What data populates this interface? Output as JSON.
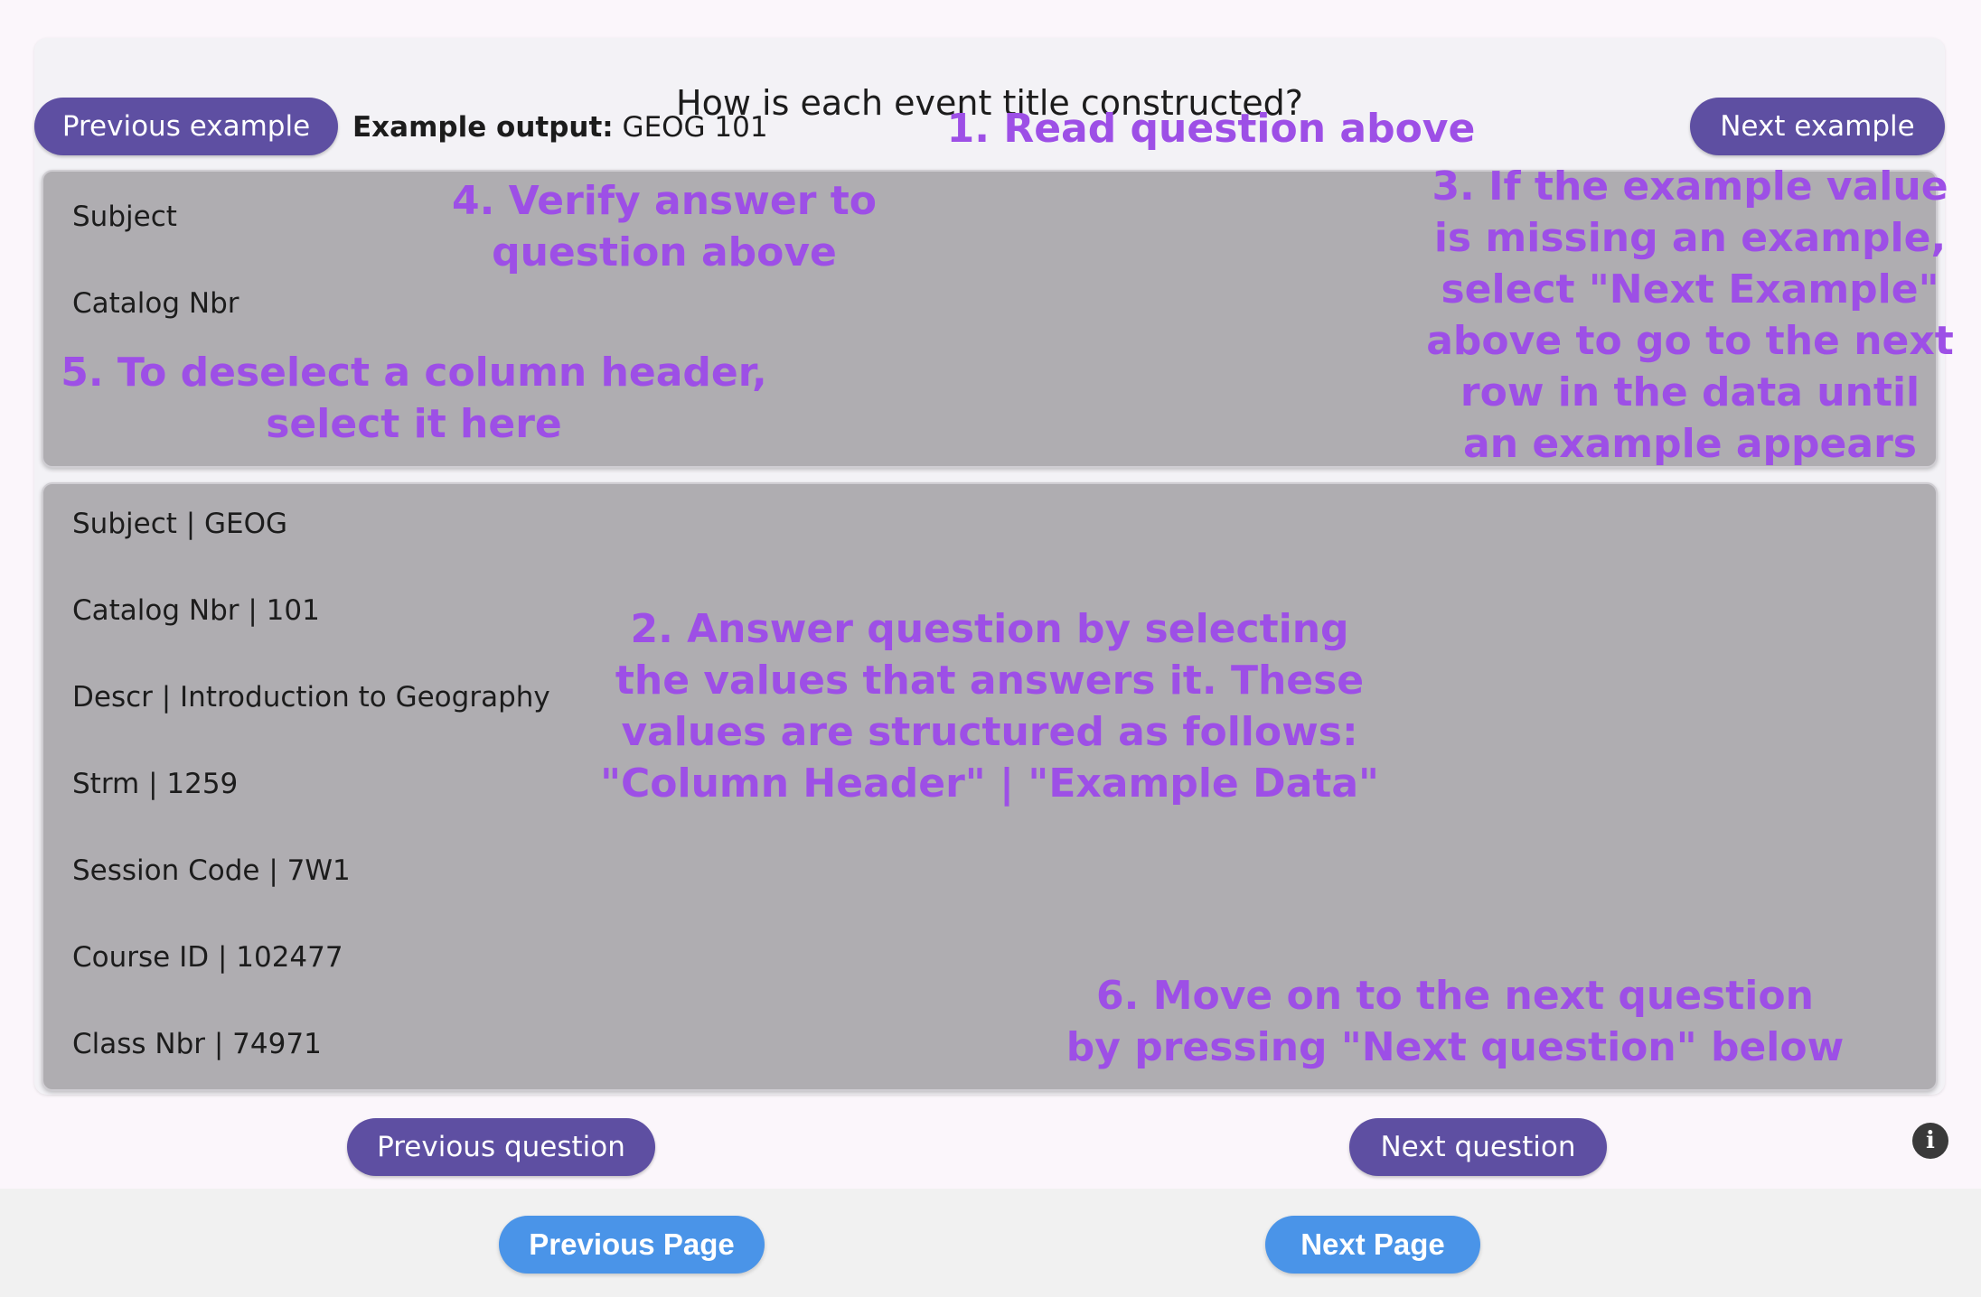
{
  "question": {
    "title": "How is each event title constructed?"
  },
  "example_nav": {
    "previous_label": "Previous example",
    "next_label": "Next example",
    "output_label": "Example output:",
    "output_value": " GEOG 101"
  },
  "selected_columns": [
    "Subject",
    "Catalog Nbr"
  ],
  "available_values": [
    "Subject | GEOG",
    "Catalog Nbr | 101",
    "Descr | Introduction to Geography",
    "Strm | 1259",
    "Session Code | 7W1",
    "Course ID | 102477",
    "Class Nbr | 74971"
  ],
  "question_nav": {
    "previous_label": "Previous question",
    "next_label": "Next question"
  },
  "info_icon": {
    "glyph": "i",
    "icon": "info-icon"
  },
  "page_nav": {
    "previous_label": "Previous Page",
    "next_label": "Next Page"
  },
  "annotations": {
    "step1": [
      "1. Read question above"
    ],
    "step2": [
      "2. Answer question by selecting",
      "the values that answers it. These",
      "values are structured as follows:",
      "\"Column Header\" | \"Example Data\""
    ],
    "step3": [
      "3. If the example value",
      "is missing an example,",
      "select \"Next Example\"",
      "above to go to the next",
      "row in the data until",
      "an example appears"
    ],
    "step4": [
      "4. Verify answer to",
      "question above"
    ],
    "step5": [
      "5. To deselect a column header,",
      "select it here"
    ],
    "step6": [
      "6. Move on to the next question",
      "by pressing \"Next question\" below"
    ]
  },
  "colors": {
    "accent_button": "#5e4fa2",
    "page_button": "#4a94e8",
    "annotation": "#9d4fe6",
    "panel": "#afadb1"
  }
}
